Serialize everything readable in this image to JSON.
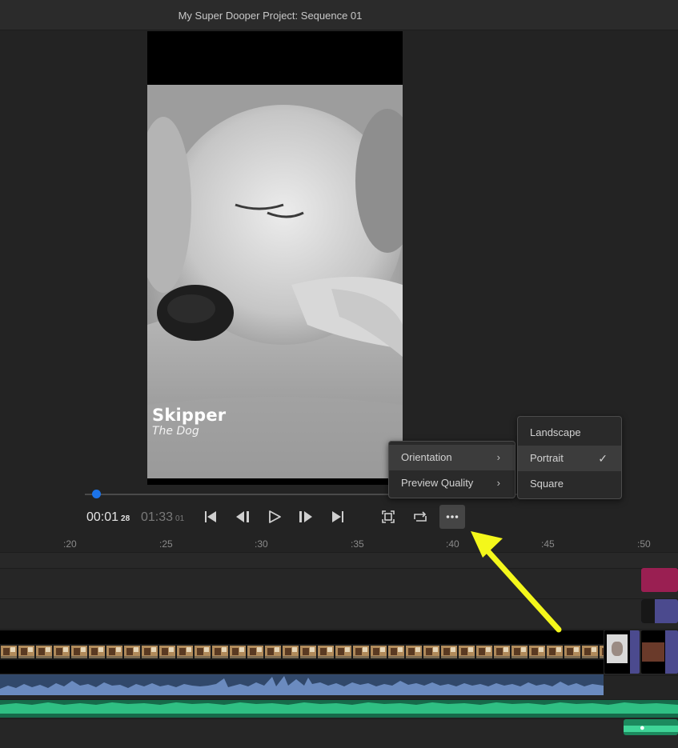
{
  "window": {
    "title": "My Super Dooper Project: Sequence 01"
  },
  "viewer": {
    "overlay_title": "Skipper",
    "overlay_subtitle": "The Dog",
    "playhead_position": 0.02
  },
  "transport": {
    "current_time": "00:01",
    "current_frames": "28",
    "duration_time": "01:33",
    "duration_frames": "01",
    "buttons": [
      "skip-to-start-icon",
      "step-back-icon",
      "play-icon",
      "step-forward-icon",
      "skip-to-end-icon",
      "fit-icon",
      "loop-icon",
      "more-icon"
    ]
  },
  "menu": {
    "items": [
      {
        "label": "Orientation",
        "submenu": true
      },
      {
        "label": "Preview Quality",
        "submenu": true
      }
    ]
  },
  "submenu": {
    "items": [
      {
        "label": "Landscape",
        "checked": false
      },
      {
        "label": "Portrait",
        "checked": true
      },
      {
        "label": "Square",
        "checked": false
      }
    ]
  },
  "timeline": {
    "ruler": [
      ":20",
      ":25",
      ":30",
      ":35",
      ":40",
      ":45",
      ":50"
    ]
  },
  "colors": {
    "accent": "#1c73e8",
    "title_clip": "#9a1f52",
    "graphic_clip": "#4b4a8e",
    "audio": "#31486a",
    "music": "#166a4a",
    "annotation_arrow": "#f4f71b"
  }
}
